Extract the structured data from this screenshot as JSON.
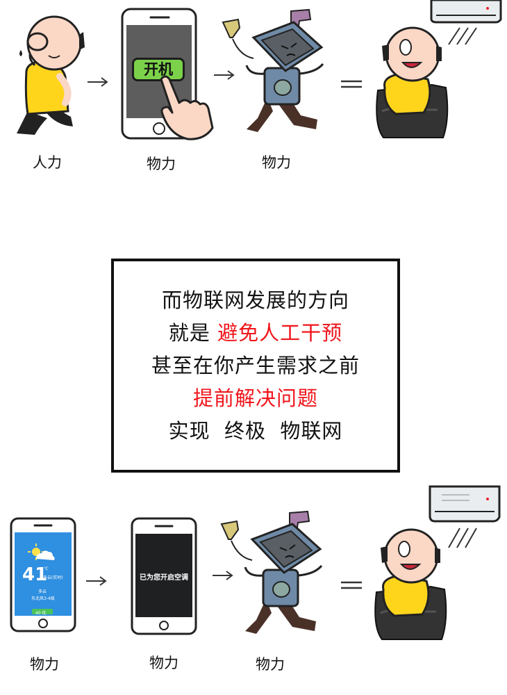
{
  "top_row": {
    "labels": [
      "人力",
      "物力",
      "物力"
    ],
    "power_button": "开机"
  },
  "message_box": {
    "lines": [
      [
        {
          "text": "而物联网发展的方向",
          "red": false
        }
      ],
      [
        {
          "text": "就是 ",
          "red": false
        },
        {
          "text": "避免人工干预",
          "red": true
        }
      ],
      [
        {
          "text": "甚至在你产生需求之前",
          "red": false
        }
      ],
      [
        {
          "text": "提前解决问题",
          "red": true
        }
      ],
      [
        {
          "text": "实现  终极  物联网",
          "red": false
        }
      ]
    ]
  },
  "bottom_row": {
    "labels": [
      "物力",
      "物力",
      "物力"
    ],
    "weather": {
      "temperature": "41",
      "unit": "℃",
      "condition_short": "多云(实时)",
      "condition": "多云",
      "wind": "东北风3-4级",
      "aqi": "40 优"
    },
    "ac_message": "已为您开启空调"
  },
  "colors": {
    "accent_red": "#f0151b",
    "shirt_yellow": "#ffd51c",
    "skin": "#fbd7c6",
    "button_green": "#7bd24a",
    "weather_blue": "#2f8fe0",
    "robot_blue": "#6f8aa6"
  }
}
